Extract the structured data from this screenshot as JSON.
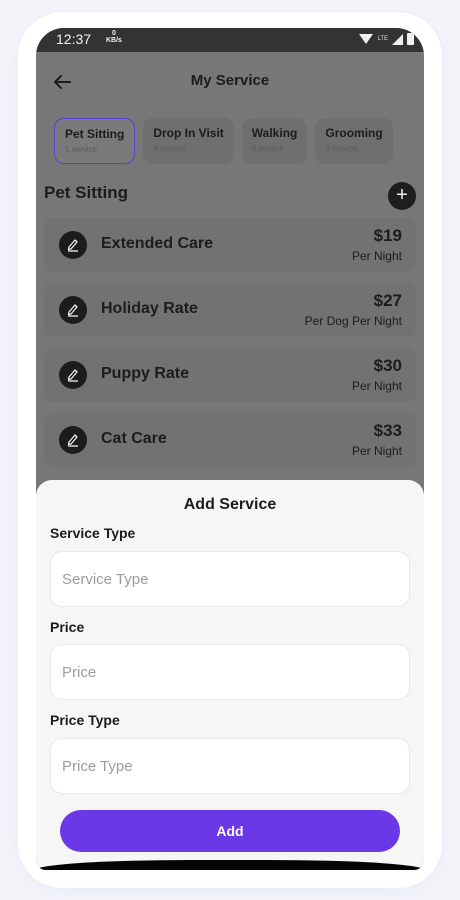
{
  "status_bar": {
    "time": "12:37",
    "kbs_value": "0",
    "kbs_unit": "KB/s",
    "lte": "LTE"
  },
  "header": {
    "title": "My Service"
  },
  "tabs": [
    {
      "label": "Pet Sitting",
      "count": "5 service"
    },
    {
      "label": "Drop In Visit",
      "count": "4 service"
    },
    {
      "label": "Walking",
      "count": "0 service"
    },
    {
      "label": "Grooming",
      "count": "3 service"
    }
  ],
  "section": {
    "title": "Pet Sitting",
    "add_icon": "+"
  },
  "services": [
    {
      "name": "Extended Care",
      "price": "$19",
      "unit": "Per Night"
    },
    {
      "name": "Holiday Rate",
      "price": "$27",
      "unit": "Per Dog Per Night"
    },
    {
      "name": "Puppy Rate",
      "price": "$30",
      "unit": "Per Night"
    },
    {
      "name": "Cat Care",
      "price": "$33",
      "unit": "Per Night"
    }
  ],
  "sheet": {
    "title": "Add Service",
    "service_type_label": "Service Type",
    "service_type_placeholder": "Service Type",
    "price_label": "Price",
    "price_placeholder": "Price",
    "price_type_label": "Price Type",
    "price_type_placeholder": "Price Type",
    "add_label": "Add"
  },
  "colors": {
    "accent": "#6b38e8",
    "tab_active_border": "#5a3fd4",
    "overlay": "#777777"
  },
  "icons": {
    "back": "arrow-left-icon",
    "edit": "pencil-icon",
    "add": "plus-icon"
  }
}
